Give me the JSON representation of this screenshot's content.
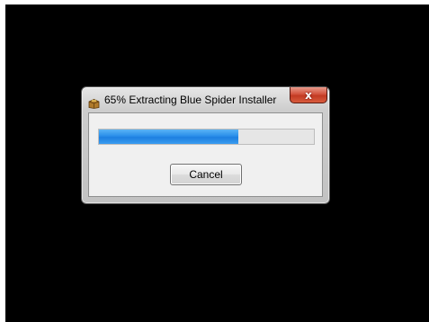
{
  "dialog": {
    "title": "65% Extracting Blue Spider Installer",
    "progress_percent": 65,
    "cancel_label": "Cancel",
    "close_glyph": "x",
    "app_icon": "installer-box-icon"
  },
  "colors": {
    "desktop": "#000000",
    "progress_fill": "#2a8fea",
    "close_button": "#c9452e"
  }
}
